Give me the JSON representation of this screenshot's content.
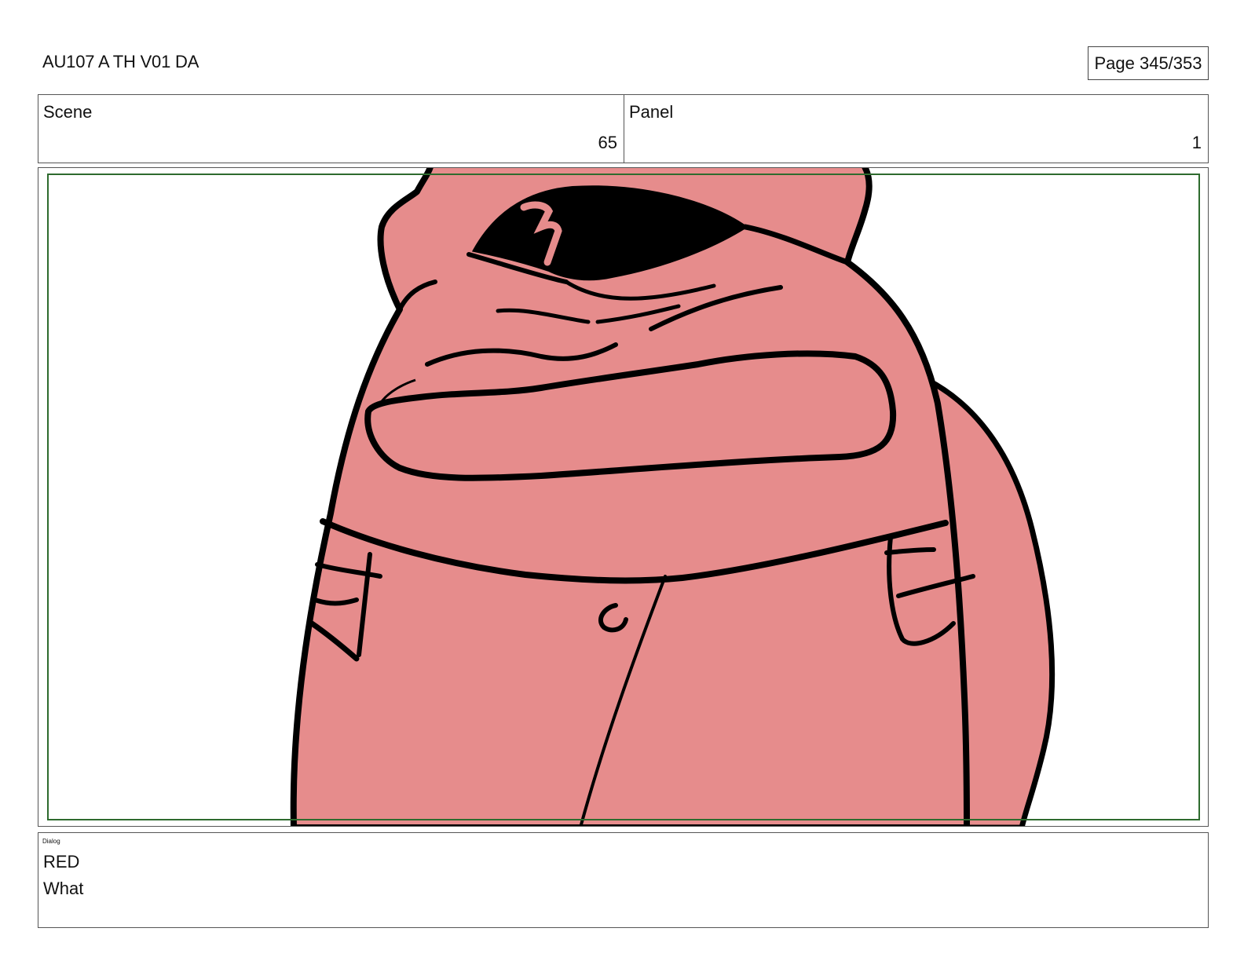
{
  "header": {
    "title": "AU107 A TH V01 DA",
    "page": "Page 345/353"
  },
  "info": {
    "scene_label": "Scene",
    "scene_value": "65",
    "panel_label": "Panel",
    "panel_value": "1"
  },
  "artwork": {
    "subject": "red-crewmate-character",
    "fill_color": "#e68c8c",
    "line_color": "#000000",
    "safe_area_color": "#2e6b2e"
  },
  "dialog": {
    "label": "Dialog",
    "speaker": "RED",
    "line": "What"
  }
}
